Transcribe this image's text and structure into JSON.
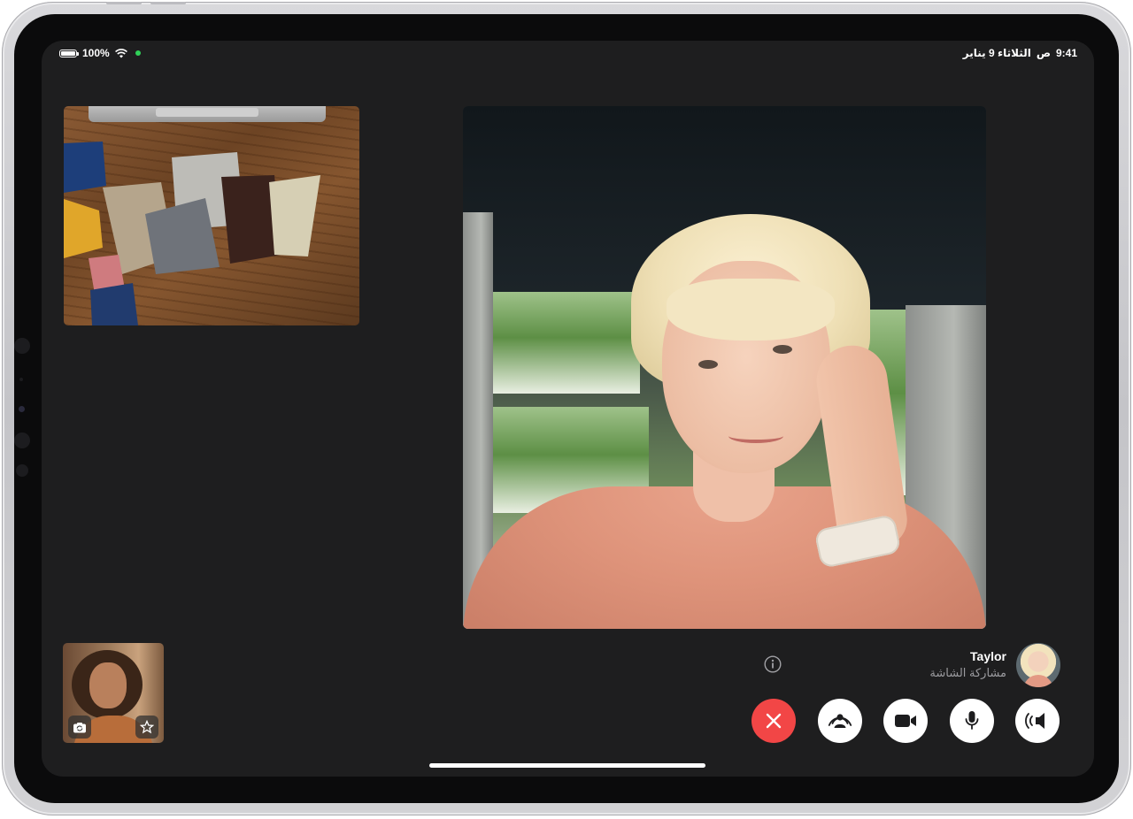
{
  "status_bar": {
    "battery_percent": "100%",
    "wifi_icon": "wifi-icon",
    "camera_in_use_dot_color": "#30d158",
    "time": "9:41",
    "period": "ص",
    "date": "الثلاثاء 9 يناير"
  },
  "call": {
    "participant": {
      "name": "Taylor",
      "status": "مشاركة الشاشة"
    },
    "info_icon": "info-icon",
    "controls": [
      {
        "name": "end-call-button",
        "icon": "close-icon",
        "color": "#f24646"
      },
      {
        "name": "shareplay-button",
        "icon": "shareplay-icon"
      },
      {
        "name": "camera-toggle-button",
        "icon": "video-camera-icon"
      },
      {
        "name": "microphone-button",
        "icon": "microphone-icon"
      },
      {
        "name": "audio-output-button",
        "icon": "speaker-icon"
      }
    ],
    "self_view": {
      "flip_camera_icon": "camera-flip-icon",
      "effects_icon": "effects-star-icon"
    }
  },
  "colors": {
    "screen_background": "#1e1e1f",
    "end_call": "#f24646",
    "control_button": "#ffffff",
    "secondary_text": "#9c9ca0"
  }
}
